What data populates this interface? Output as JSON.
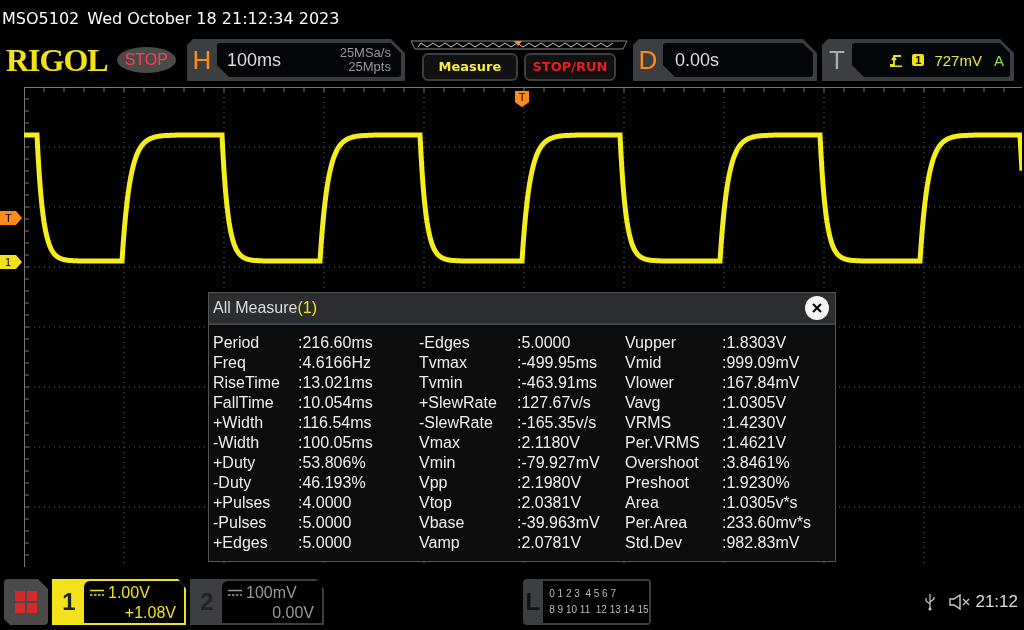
{
  "header": {
    "model": "MSO5102",
    "datetime": "Wed October 18 21:12:34 2023"
  },
  "toolbar": {
    "logo": "RIGOL",
    "run_state": "STOP",
    "horizontal": {
      "letter": "H",
      "timebase": "100ms",
      "sample_rate": "25MSa/s",
      "memory_depth": "25Mpts"
    },
    "buttons": [
      {
        "label": "Measure",
        "kind": "measure"
      },
      {
        "label": "STOP/RUN",
        "kind": "run"
      }
    ],
    "delay": {
      "letter": "D",
      "value": "0.00s"
    },
    "trigger": {
      "letter": "T",
      "source": "1",
      "level": "727mV",
      "mode": "A"
    }
  },
  "screen": {
    "position_marker": "T",
    "markers": [
      {
        "label": "T",
        "kind": "trigger"
      },
      {
        "label": "1",
        "kind": "channel"
      }
    ]
  },
  "measure_dialog": {
    "title": "All Measure",
    "source": "(1)",
    "rows": [
      [
        {
          "name": "Period",
          "value": ":216.60ms"
        },
        {
          "name": "-Edges",
          "value": ":5.0000"
        },
        {
          "name": "Vupper",
          "value": ":1.8303V"
        }
      ],
      [
        {
          "name": "Freq",
          "value": ":4.6166Hz"
        },
        {
          "name": "Tvmax",
          "value": ":-499.95ms"
        },
        {
          "name": "Vmid",
          "value": ":999.09mV"
        }
      ],
      [
        {
          "name": "RiseTime",
          "value": ":13.021ms"
        },
        {
          "name": "Tvmin",
          "value": ":-463.91ms"
        },
        {
          "name": "Vlower",
          "value": ":167.84mV"
        }
      ],
      [
        {
          "name": "FallTime",
          "value": ":10.054ms"
        },
        {
          "name": "+SlewRate",
          "value": ":127.67v/s"
        },
        {
          "name": "Vavg",
          "value": ":1.0305V"
        }
      ],
      [
        {
          "name": "+Width",
          "value": ":116.54ms"
        },
        {
          "name": "-SlewRate",
          "value": ":-165.35v/s"
        },
        {
          "name": "VRMS",
          "value": ":1.4230V"
        }
      ],
      [
        {
          "name": "-Width",
          "value": ":100.05ms"
        },
        {
          "name": "Vmax",
          "value": ":2.1180V"
        },
        {
          "name": "Per.VRMS",
          "value": ":1.4621V"
        }
      ],
      [
        {
          "name": "+Duty",
          "value": ":53.806%"
        },
        {
          "name": "Vmin",
          "value": ":-79.927mV"
        },
        {
          "name": "Overshoot",
          "value": ":3.8461%"
        }
      ],
      [
        {
          "name": "-Duty",
          "value": ":46.193%"
        },
        {
          "name": "Vpp",
          "value": ":2.1980V"
        },
        {
          "name": "Preshoot",
          "value": ":1.9230%"
        }
      ],
      [
        {
          "name": "+Pulses",
          "value": ":4.0000"
        },
        {
          "name": "Vtop",
          "value": ":2.0381V"
        },
        {
          "name": "Area",
          "value": ":1.0305v*s"
        }
      ],
      [
        {
          "name": "-Pulses",
          "value": ":5.0000"
        },
        {
          "name": "Vbase",
          "value": ":-39.963mV"
        },
        {
          "name": "Per.Area",
          "value": ":233.60mv*s"
        }
      ],
      [
        {
          "name": "+Edges",
          "value": ":5.0000"
        },
        {
          "name": "Vamp",
          "value": ":2.0781V"
        },
        {
          "name": "Std.Dev",
          "value": ":982.83mV"
        }
      ]
    ]
  },
  "channels": [
    {
      "number": "1",
      "scale": "1.00V",
      "offset": "+1.08V",
      "selected": true
    },
    {
      "number": "2",
      "scale": "100mV",
      "offset": "0.00V",
      "selected": false
    }
  ],
  "logic": {
    "letter": "L",
    "rows": [
      "0 1 2 3  4 5 6 7",
      "8 9 10 11  12 13 14 15"
    ]
  },
  "status": {
    "time": "21:12"
  }
}
